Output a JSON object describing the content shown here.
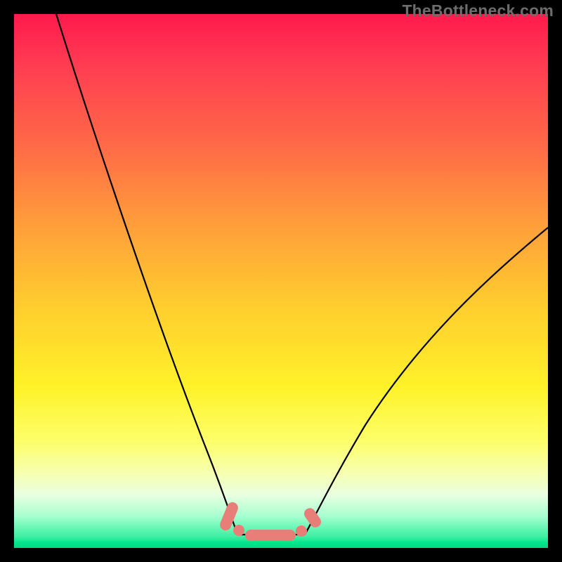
{
  "watermark": "TheBottleneck.com",
  "chart_data": {
    "type": "line",
    "title": "",
    "xlabel": "",
    "ylabel": "",
    "xlim": [
      0,
      100
    ],
    "ylim": [
      0,
      100
    ],
    "grid": false,
    "legend": false,
    "series": [
      {
        "name": "left-curve",
        "x": [
          8,
          12,
          16,
          20,
          24,
          28,
          32,
          36,
          40,
          41.5
        ],
        "y": [
          100,
          87,
          74,
          61,
          48,
          35,
          23,
          12,
          4,
          2.4
        ]
      },
      {
        "name": "right-curve",
        "x": [
          54.5,
          58,
          62,
          66,
          72,
          78,
          85,
          92,
          100
        ],
        "y": [
          2.4,
          4,
          8,
          14,
          24,
          34,
          44,
          52,
          60
        ]
      },
      {
        "name": "bottom-flat",
        "x": [
          41.5,
          54.5
        ],
        "y": [
          2.4,
          2.4
        ]
      }
    ],
    "markers": [
      {
        "name": "left-pill-1",
        "cx": 40.3,
        "cy": 5.9,
        "shape": "pill",
        "angle": -68
      },
      {
        "name": "left-dot-1",
        "cx": 42.2,
        "cy": 3.3,
        "shape": "dot"
      },
      {
        "name": "bottom-pill",
        "cx": 48.0,
        "cy": 2.4,
        "shape": "long-pill",
        "angle": 0
      },
      {
        "name": "right-dot-1",
        "cx": 53.8,
        "cy": 3.1,
        "shape": "dot"
      },
      {
        "name": "right-pill-1",
        "cx": 55.9,
        "cy": 5.6,
        "shape": "short-pill",
        "angle": 55
      }
    ],
    "colors": {
      "curve": "#000000",
      "marker": "#e77f78",
      "gradient_top": "#ff1a4d",
      "gradient_mid": "#ffe22a",
      "gradient_bottom": "#00e88a"
    }
  }
}
